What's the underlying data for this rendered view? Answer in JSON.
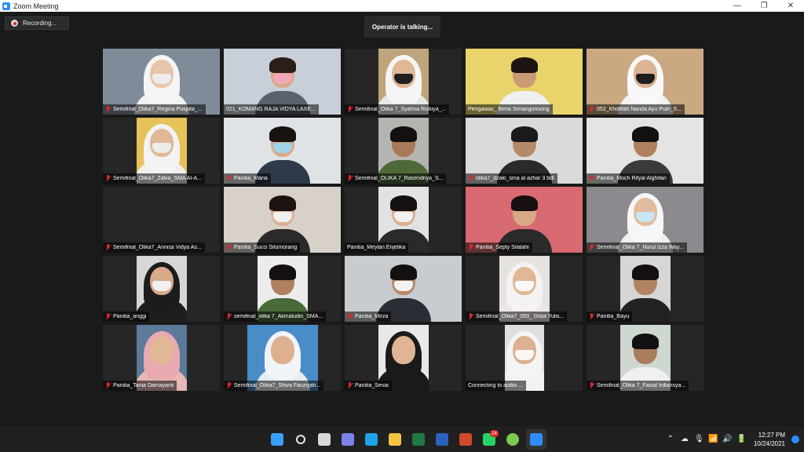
{
  "window": {
    "title": "Zoom Meeting",
    "controls": [
      "—",
      "❐",
      "✕"
    ]
  },
  "recording": {
    "label": "Recording..."
  },
  "status": {
    "operator": "Operator is talking..."
  },
  "participants": [
    {
      "name": "Semifinal_Olika7_Regina Puspita_...",
      "muted": true,
      "bg": "#7e8c9a",
      "skin": "#e8c4a8",
      "wear": "#f0f0f0",
      "video": "full",
      "style": "hijab",
      "hijab": "#f5f5f5",
      "mask": "#ededed"
    },
    {
      "name": "021_KOMANG RAJA VIDYA LAXE...",
      "muted": false,
      "bg": "#c8cfd8",
      "skin": "#d9a98a",
      "wear": "#5a6270",
      "video": "full",
      "style": "hair",
      "hair": "#2a1e18",
      "mask": "#f2a8b8"
    },
    {
      "name": "Semifinal_Olika 7_Syahna Rizkiya_...",
      "muted": true,
      "bg": "#bfa57d",
      "skin": "#e0b896",
      "wear": "#e8e8e8",
      "video": "mid",
      "style": "hijab",
      "hijab": "#f5f5f5",
      "mask": "#202020"
    },
    {
      "name": "Pengawas_ Beria Simangunsong",
      "muted": false,
      "bg": "#e8d46a",
      "skin": "#c99a74",
      "wear": "#f0f0f0",
      "video": "full",
      "style": "hair",
      "hair": "#1c1410",
      "mask": ""
    },
    {
      "name": "052_Khofifah Nanda Ayu Putri_S...",
      "muted": true,
      "bg": "#c9a882",
      "skin": "#dcb394",
      "wear": "#f2f2f2",
      "video": "full",
      "style": "hijab",
      "hijab": "#f8f8f8",
      "mask": "#1e1e1e"
    },
    {
      "name": "Semifinal_Olika7_Zalva_SMA Al-A...",
      "muted": true,
      "bg": "#e6c25a",
      "skin": "#e0b896",
      "wear": "#efefef",
      "video": "mid",
      "style": "hijab",
      "hijab": "#f3f3f3",
      "mask": "#ececec"
    },
    {
      "name": "Panitia_Maria",
      "muted": true,
      "bg": "#dfe3e6",
      "skin": "#d8aa8a",
      "wear": "#2e3a48",
      "video": "full",
      "style": "hair",
      "hair": "#181210",
      "mask": "#9fd3ea"
    },
    {
      "name": "Semifinal_OLIKA 7_Rasendriya_S...",
      "muted": true,
      "bg": "#b4b4b0",
      "skin": "#a87a5a",
      "wear": "#4e6a3a",
      "video": "mid",
      "style": "hair",
      "hair": "#141010",
      "mask": ""
    },
    {
      "name": "olika7_dzaki_sma al azhar 3 bdl",
      "muted": true,
      "bg": "#dadada",
      "skin": "#b58a68",
      "wear": "#2a2a2a",
      "video": "full",
      "style": "hair",
      "hair": "#1a1a1a",
      "mask": ""
    },
    {
      "name": "Panitia_Moch Rifyal Alghifari",
      "muted": true,
      "bg": "#e4e4e2",
      "skin": "#b08060",
      "wear": "#3a3a3a",
      "video": "full",
      "style": "hair",
      "hair": "#121010",
      "mask": ""
    },
    {
      "name": "Semifinal_Olika7_Annisa Vidya As...",
      "muted": true,
      "bg": "#262626",
      "skin": "",
      "wear": "",
      "video": "none",
      "style": "none",
      "mask": ""
    },
    {
      "name": "Panitia_Succi Situmorang",
      "muted": true,
      "bg": "#d7d1ca",
      "skin": "#dcb094",
      "wear": "#2a2a2a",
      "video": "full",
      "style": "hair",
      "hair": "#1c1410",
      "mask": "#f0f0f0"
    },
    {
      "name": "Panitia_Meylan Enjelika",
      "muted": false,
      "bg": "#e2e2e2",
      "skin": "#dcb094",
      "wear": "#2a2a2a",
      "video": "mid",
      "style": "hair",
      "hair": "#141010",
      "mask": "#f2f2f2"
    },
    {
      "name": "Panitia_Septy Silalahi",
      "muted": true,
      "bg": "#d86a72",
      "skin": "#d9a988",
      "wear": "#2a2a2a",
      "video": "full",
      "style": "hair",
      "hair": "#161010",
      "mask": ""
    },
    {
      "name": "Semifinal_Olika 7_Nurul Izza Way...",
      "muted": true,
      "bg": "#8c8a8e",
      "skin": "#e2bc9c",
      "wear": "#f0f0f0",
      "video": "full",
      "style": "hijab",
      "hijab": "#f6f6f6",
      "mask": "#c9e4f2"
    },
    {
      "name": "Panitia_anggi",
      "muted": true,
      "bg": "#d8d6d4",
      "skin": "#d8aa8a",
      "wear": "#1e1e1e",
      "video": "mid",
      "style": "hijab",
      "hijab": "#1c1c1c",
      "mask": "#f0f0f0"
    },
    {
      "name": "semifinal_olika 7_Akmaludin_SMA...",
      "muted": true,
      "bg": "#ececec",
      "skin": "#b08060",
      "wear": "#4a6a3a",
      "video": "mid",
      "style": "hair",
      "hair": "#141010",
      "mask": ""
    },
    {
      "name": "Panitia_Mirza",
      "muted": true,
      "bg": "#c8ccd0",
      "skin": "#b88868",
      "wear": "#2a2e34",
      "video": "full",
      "style": "hair",
      "hair": "#141010",
      "mask": "#f2f2f2"
    },
    {
      "name": "Semifinal_Olika7_050_ Dista Yulis...",
      "muted": true,
      "bg": "#e6e2de",
      "skin": "#e0b896",
      "wear": "#f0e6e8",
      "video": "mid",
      "style": "hijab",
      "hijab": "#f4f2f2",
      "mask": "#f8f8f8"
    },
    {
      "name": "Panitia_Bayu",
      "muted": true,
      "bg": "#d6d6d4",
      "skin": "#b08462",
      "wear": "#222",
      "video": "mid",
      "style": "hair",
      "hair": "#141010",
      "mask": ""
    },
    {
      "name": "Panitia_Tania Damayanti",
      "muted": true,
      "bg": "#5c7a9a",
      "skin": "#e0b896",
      "wear": "#e8b8b8",
      "video": "mid",
      "style": "hijab",
      "hijab": "#e8aab0",
      "mask": ""
    },
    {
      "name": "Semifinal_Olika7_Shiva Fauziyah...",
      "muted": true,
      "bg": "#4a8cc8",
      "skin": "#dcb090",
      "wear": "#e6ecf0",
      "video": "wide",
      "style": "hijab",
      "hijab": "#f0f4f6",
      "mask": ""
    },
    {
      "name": "Panitia_Sevia",
      "muted": true,
      "bg": "#e8e8e8",
      "skin": "#e0b494",
      "wear": "#1a1a1a",
      "video": "mid",
      "style": "hijab",
      "hijab": "#1a1a1a",
      "mask": ""
    },
    {
      "name": "Connecting to audio ...",
      "muted": false,
      "bg": "#e0dede",
      "skin": "#dcb090",
      "wear": "#f2f2f2",
      "video": "narrow",
      "style": "hijab",
      "hijab": "#f4f4f4",
      "mask": "#f8f8f8"
    },
    {
      "name": "Semifinal_Olika 7_Faisal Irdiansya...",
      "muted": true,
      "bg": "#cfd8d0",
      "skin": "#a87c5c",
      "wear": "#f0f0f0",
      "video": "mid",
      "style": "hair",
      "hair": "#121010",
      "mask": ""
    }
  ],
  "taskbar": {
    "apps": [
      {
        "name": "windows-start-icon",
        "color": "#3aa0ff",
        "active": false,
        "badge": ""
      },
      {
        "name": "search-icon",
        "color": "#e6e6e6",
        "active": false,
        "badge": ""
      },
      {
        "name": "task-view-icon",
        "color": "#d8d8d8",
        "active": false,
        "badge": ""
      },
      {
        "name": "teams-chat-icon",
        "color": "#7b83eb",
        "active": false,
        "badge": ""
      },
      {
        "name": "edge-icon",
        "color": "#1fa3e6",
        "active": false,
        "badge": ""
      },
      {
        "name": "file-explorer-icon",
        "color": "#f4c542",
        "active": false,
        "badge": ""
      },
      {
        "name": "excel-icon",
        "color": "#1e7a45",
        "active": false,
        "badge": ""
      },
      {
        "name": "word-icon",
        "color": "#2b62c0",
        "active": false,
        "badge": ""
      },
      {
        "name": "powerpoint-icon",
        "color": "#d0492b",
        "active": false,
        "badge": ""
      },
      {
        "name": "whatsapp-icon",
        "color": "#25d366",
        "active": false,
        "badge": "24"
      },
      {
        "name": "heart-app-icon",
        "color": "#7ec850",
        "active": false,
        "badge": ""
      },
      {
        "name": "zoom-icon",
        "color": "#2d8cff",
        "active": true,
        "badge": ""
      }
    ],
    "tray": {
      "icons": [
        {
          "name": "chevron-up-icon",
          "glyph": "⌃"
        },
        {
          "name": "cloud-icon",
          "glyph": "☁"
        },
        {
          "name": "mic-tray-icon",
          "glyph": "🎙"
        },
        {
          "name": "wifi-icon",
          "glyph": "📶"
        },
        {
          "name": "volume-icon",
          "glyph": "🔊"
        },
        {
          "name": "battery-icon",
          "glyph": "🔋"
        }
      ],
      "time": "12:27 PM",
      "date": "10/24/2021"
    }
  }
}
